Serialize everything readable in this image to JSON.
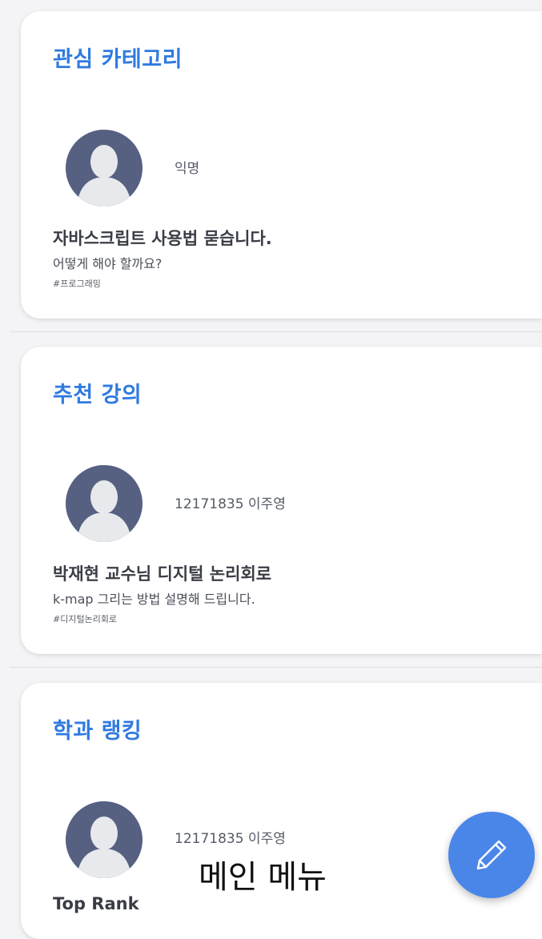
{
  "sections": [
    {
      "title": "관심 카테고리",
      "author": "익명",
      "post_title": "자바스크립트 사용법 묻습니다.",
      "post_body": "어떻게 해야 할까요?",
      "tag": "#프로그래밍"
    },
    {
      "title": "추천 강의",
      "author": "12171835 이주영",
      "post_title": "박재현 교수님 디지털 논리회로",
      "post_body": "k-map 그리는 방법 설명해 드립니다.",
      "tag": "#디지털논리회로"
    },
    {
      "title": "학과 랭킹",
      "author": "12171835 이주영",
      "post_title": "Top Rank"
    }
  ],
  "bottom_label": "메인 메뉴",
  "fab": {
    "icon": "pencil-icon"
  },
  "colors": {
    "accent": "#2f7ae0",
    "fab": "#4a86e8",
    "avatar": "#566081"
  }
}
